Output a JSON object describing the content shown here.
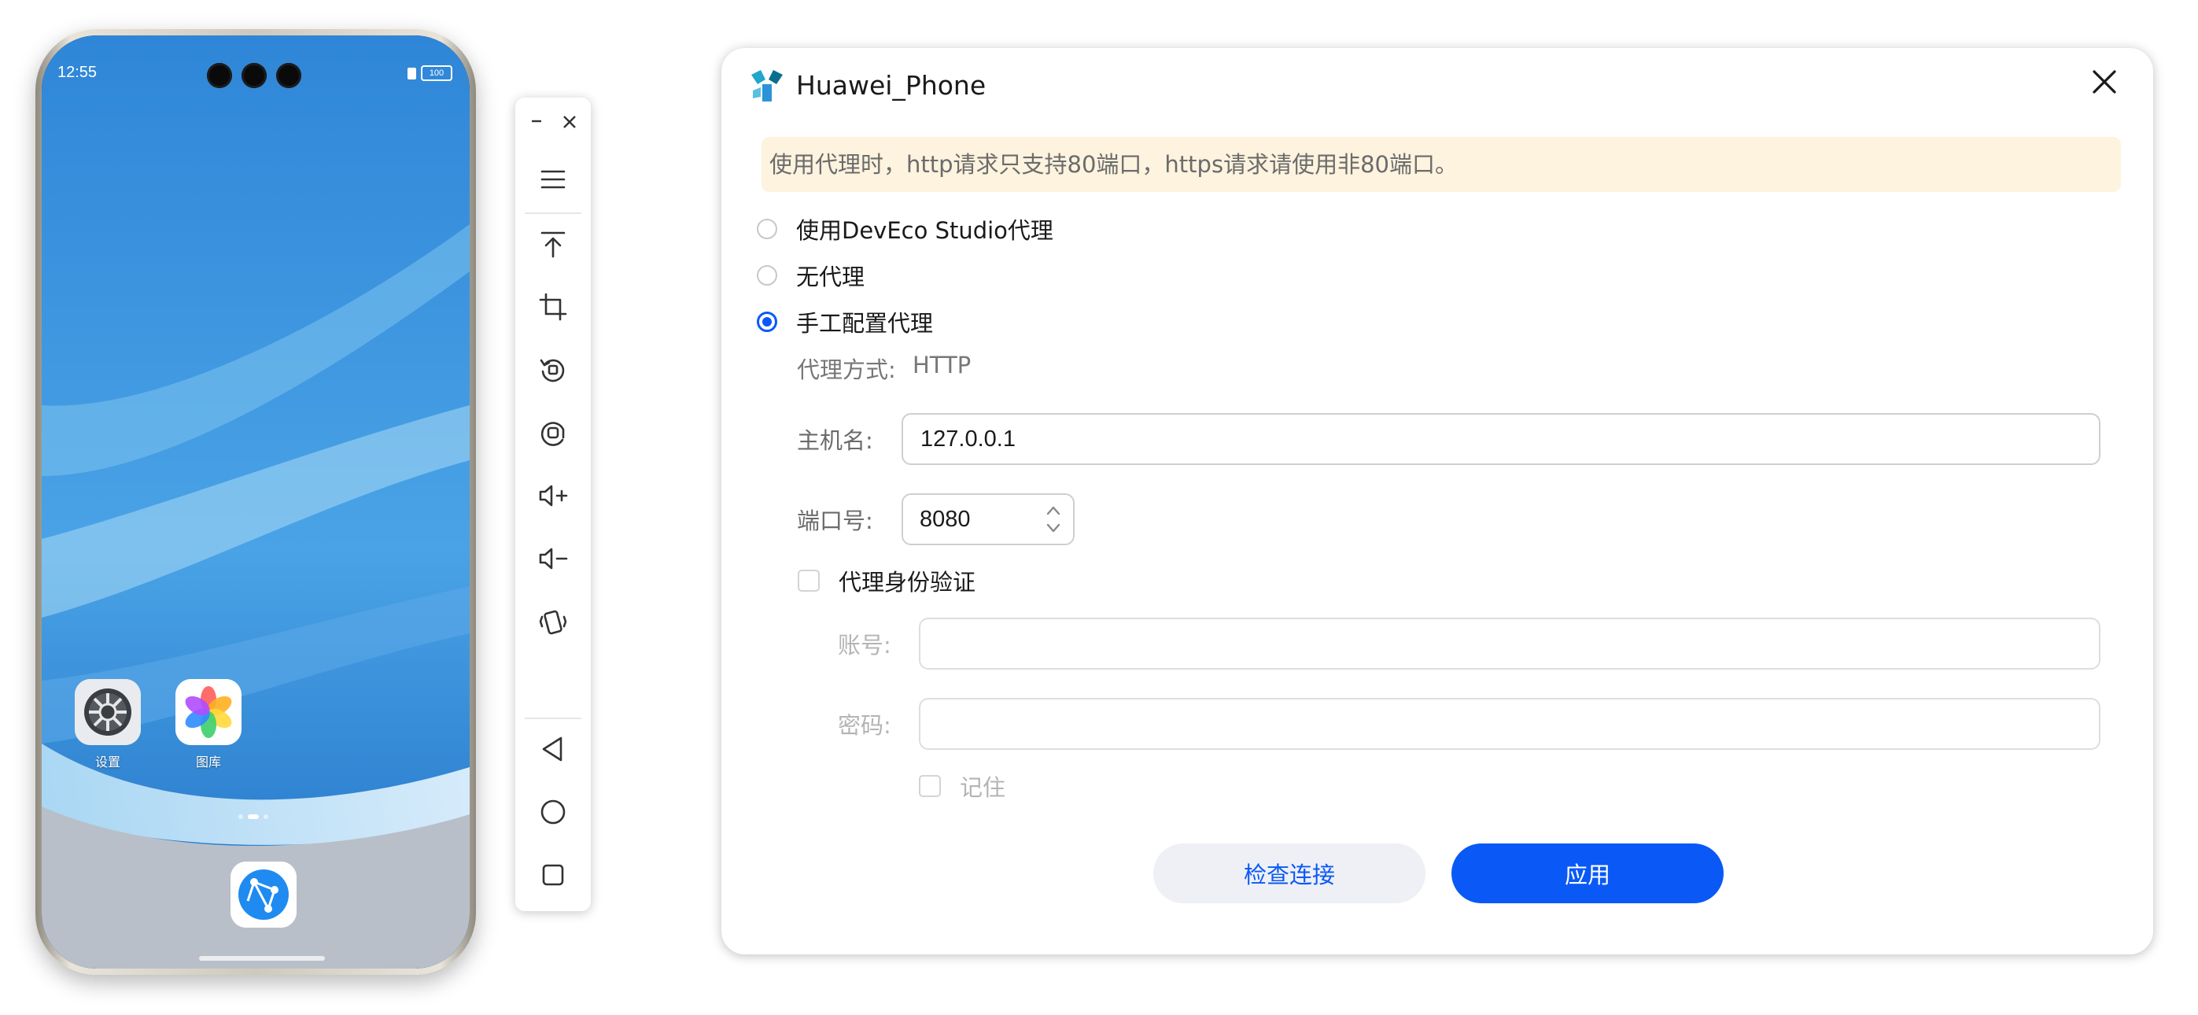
{
  "phone": {
    "status_time": "12:55",
    "battery": "100",
    "apps": [
      {
        "label": "设置",
        "icon": "settings-gear-icon"
      },
      {
        "label": "图库",
        "icon": "gallery-flower-icon"
      }
    ],
    "dock_app": {
      "icon": "browser-globe-icon"
    },
    "page_indicator": {
      "pages": 3,
      "current": 2
    }
  },
  "toolbar": {
    "buttons": [
      {
        "icon": "minimize-icon"
      },
      {
        "icon": "close-icon"
      },
      {
        "icon": "menu-icon"
      },
      {
        "icon": "pin-top-icon"
      },
      {
        "icon": "crop-screenshot-icon"
      },
      {
        "icon": "rotate-icon"
      },
      {
        "icon": "screen-record-icon"
      },
      {
        "icon": "volume-up-icon"
      },
      {
        "icon": "volume-down-icon"
      },
      {
        "icon": "shake-icon"
      },
      {
        "icon": "back-icon"
      },
      {
        "icon": "home-icon"
      },
      {
        "icon": "recents-icon"
      }
    ]
  },
  "dialog": {
    "title": "Huawei_Phone",
    "notice": "使用代理时，http请求只支持80端口，https请求请使用非80端口。",
    "options": [
      {
        "label": "使用DevEco Studio代理",
        "checked": false
      },
      {
        "label": "无代理",
        "checked": false
      },
      {
        "label": "手工配置代理",
        "checked": true
      }
    ],
    "proxy_mode_label": "代理方式:",
    "proxy_mode_value": "HTTP",
    "host_label": "主机名:",
    "host_value": "127.0.0.1",
    "port_label": "端口号:",
    "port_value": "8080",
    "auth_label": "代理身份验证",
    "auth_checked": false,
    "account_label": "账号:",
    "account_value": "",
    "password_label": "密码:",
    "password_value": "",
    "remember_label": "记住",
    "remember_checked": false,
    "check_button": "检查连接",
    "apply_button": "应用"
  },
  "colors": {
    "accent": "#0a59f7",
    "notice_bg": "#fdf3de",
    "secondary_btn_bg": "#eef0f5"
  }
}
